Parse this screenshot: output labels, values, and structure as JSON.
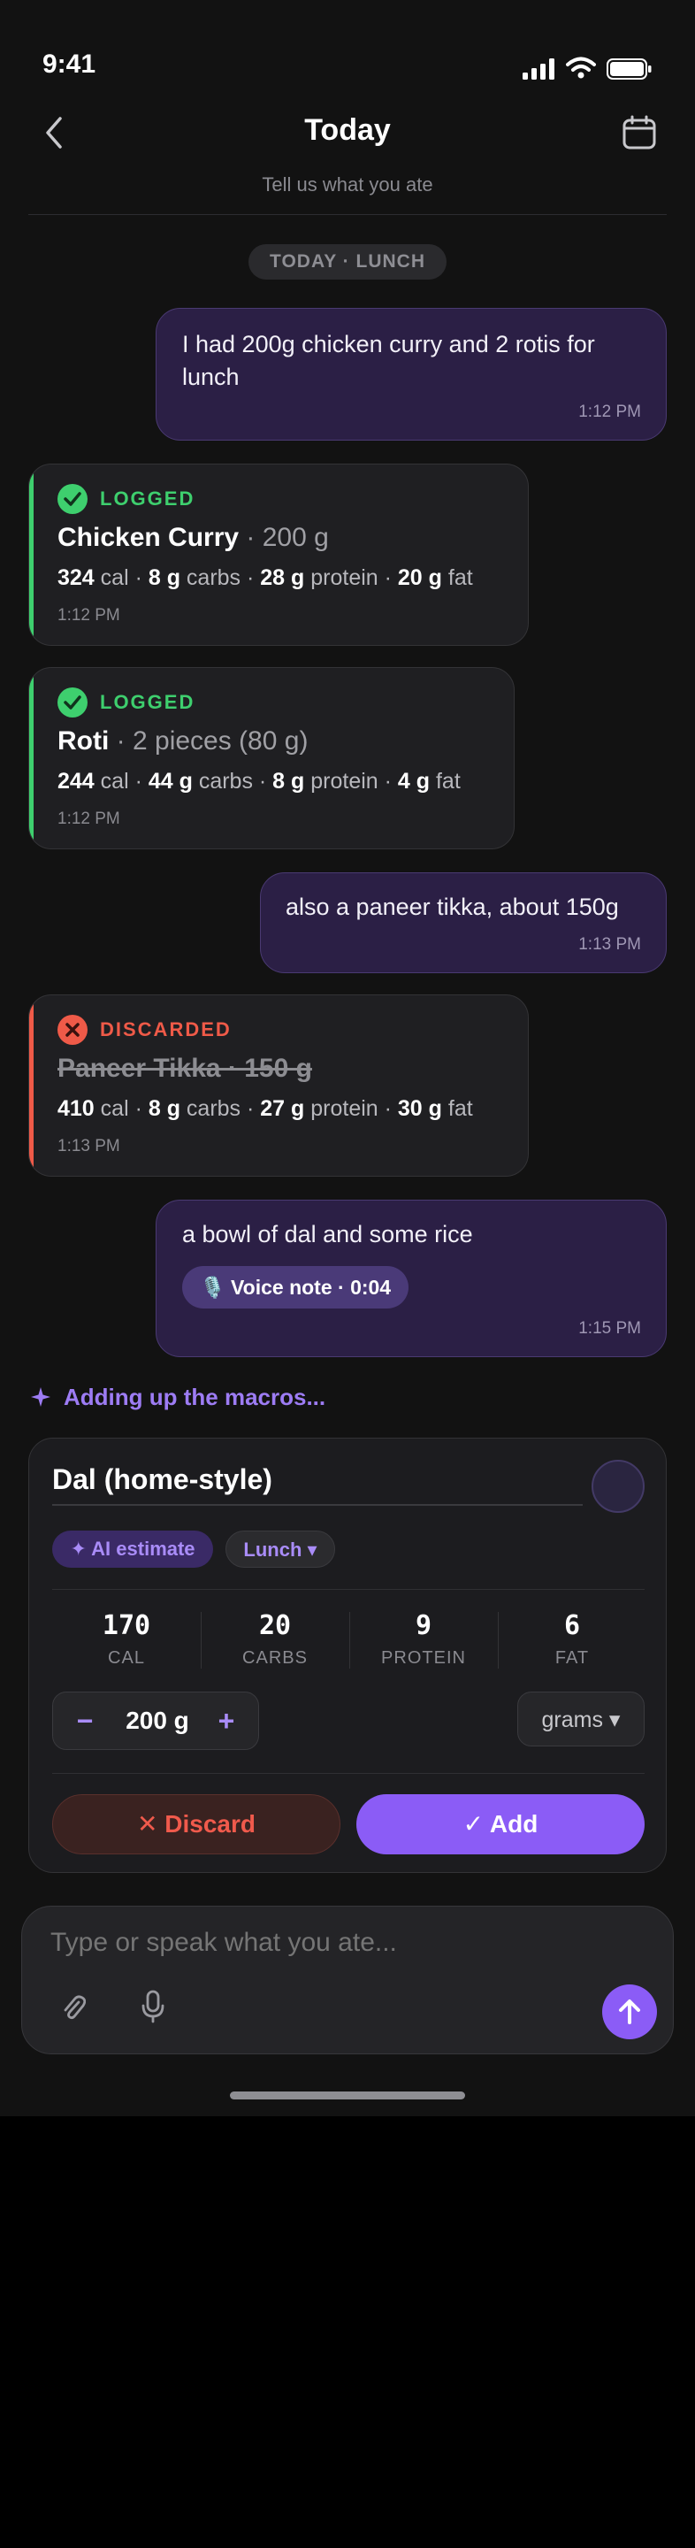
{
  "status_bar": {
    "time": "9:41"
  },
  "header": {
    "title": "Today",
    "subtitle": "Tell us what you ate"
  },
  "date_chip": "TODAY · LUNCH",
  "messages": [
    {
      "text_line1": "I had 200g chicken curry and 2 rotis for",
      "text_line2": "lunch",
      "time": "1:12 PM"
    },
    {
      "text": "also a paneer tikka, about 150g",
      "time": "1:13 PM"
    },
    {
      "text": "a bowl of dal and some rice",
      "voice_note": "🎙️ Voice note · 0:04",
      "time": "1:15 PM"
    }
  ],
  "logs": [
    {
      "status": "LOGGED",
      "name": "Chicken Curry",
      "qty": " · 200 g",
      "cal": "324",
      "carbs": "8 g",
      "protein": "28 g",
      "fat": "20 g",
      "cal_unit": " cal · ",
      "carbs_unit": " carbs · ",
      "protein_unit": " protein · ",
      "fat_unit": " fat",
      "time": "1:12 PM"
    },
    {
      "status": "LOGGED",
      "name": "Roti",
      "qty": " · 2 pieces (80 g)",
      "cal": "244",
      "carbs": "44 g",
      "protein": "8 g",
      "fat": "4 g",
      "cal_unit": " cal · ",
      "carbs_unit": " carbs · ",
      "protein_unit": " protein · ",
      "fat_unit": " fat",
      "time": "1:12 PM"
    },
    {
      "status": "DISCARDED",
      "name": "Paneer Tikka · 150 g",
      "cal": "410",
      "carbs": "8 g",
      "protein": "27 g",
      "fat": "30 g",
      "cal_unit": " cal · ",
      "carbs_unit": " carbs · ",
      "protein_unit": " protein · ",
      "fat_unit": " fat",
      "time": "1:13 PM"
    }
  ],
  "progress_text": "Adding up the macros...",
  "estimate": {
    "name": "Dal (home-style)",
    "ai_chip": "✦ AI estimate",
    "meal_chip": "Lunch ▾",
    "macros": [
      {
        "value": "170",
        "label": "CAL"
      },
      {
        "value": "20",
        "label": "CARBS"
      },
      {
        "value": "9",
        "label": "PROTEIN"
      },
      {
        "value": "6",
        "label": "FAT"
      }
    ],
    "minus": "−",
    "plus": "+",
    "amount": "200 g",
    "unit": "grams ▾",
    "discard_label": "✕ Discard",
    "add_label": "✓ Add"
  },
  "composer": {
    "placeholder": "Type or speak what you ate..."
  },
  "colors": {
    "accent": "#8b5cf6",
    "logged": "#3ecf6e",
    "discarded": "#ef5a48"
  },
  "icons": [
    "back-chevron-icon",
    "calendar-icon",
    "check-circle-icon",
    "x-circle-icon",
    "sparkle-icon",
    "paperclip-icon",
    "microphone-icon",
    "send-arrow-icon"
  ]
}
